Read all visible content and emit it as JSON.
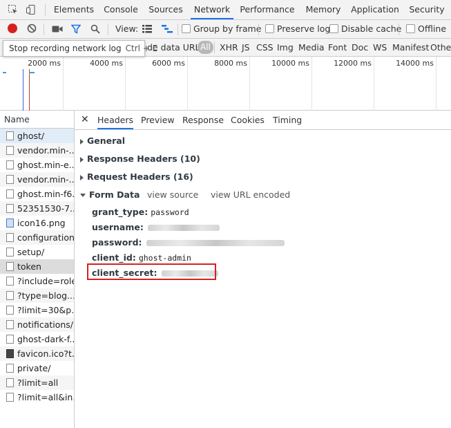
{
  "tabbar": {
    "tabs": [
      "Elements",
      "Console",
      "Sources",
      "Network",
      "Performance",
      "Memory",
      "Application",
      "Security"
    ],
    "active": "Network"
  },
  "toolbar": {
    "view_label": "View:",
    "group_by_frame": "Group by frame",
    "preserve_log": "Preserve log",
    "disable_cache": "Disable cache",
    "offline": "Offline"
  },
  "filter": {
    "hide_data_urls": "de data URLs",
    "types": [
      "All",
      "XHR",
      "JS",
      "CSS",
      "Img",
      "Media",
      "Font",
      "Doc",
      "WS",
      "Manifest",
      "Other"
    ]
  },
  "tooltip": {
    "text": "Stop recording network log",
    "shortcut": "Ctrl + E"
  },
  "overview": {
    "ticks": [
      "2000 ms",
      "4000 ms",
      "6000 ms",
      "8000 ms",
      "10000 ms",
      "12000 ms",
      "14000 ms"
    ]
  },
  "requests": {
    "header": "Name",
    "items": [
      {
        "name": "ghost/",
        "icon": "doc"
      },
      {
        "name": "vendor.min-...",
        "icon": "doc"
      },
      {
        "name": "ghost.min-e...",
        "icon": "doc"
      },
      {
        "name": "vendor.min-...",
        "icon": "doc"
      },
      {
        "name": "ghost.min-f6...",
        "icon": "doc"
      },
      {
        "name": "52351530-7...",
        "icon": "doc"
      },
      {
        "name": "icon16.png",
        "icon": "img"
      },
      {
        "name": "configuration/",
        "icon": "doc"
      },
      {
        "name": "setup/",
        "icon": "doc"
      },
      {
        "name": "token",
        "icon": "doc"
      },
      {
        "name": "?include=roles",
        "icon": "doc"
      },
      {
        "name": "?type=blog...",
        "icon": "doc"
      },
      {
        "name": "?limit=30&p...",
        "icon": "doc"
      },
      {
        "name": "notifications/",
        "icon": "doc"
      },
      {
        "name": "ghost-dark-f...",
        "icon": "doc"
      },
      {
        "name": "favicon.ico?t...",
        "icon": "fav"
      },
      {
        "name": "private/",
        "icon": "doc"
      },
      {
        "name": "?limit=all",
        "icon": "doc"
      },
      {
        "name": "?limit=all&in...",
        "icon": "doc"
      }
    ]
  },
  "details": {
    "tabs": [
      "Headers",
      "Preview",
      "Response",
      "Cookies",
      "Timing"
    ],
    "active": "Headers",
    "sections": {
      "general": "General",
      "response_headers": "Response Headers (10)",
      "request_headers": "Request Headers (16)",
      "form_data": "Form Data",
      "view_source": "view source",
      "view_url_encoded": "view URL encoded"
    },
    "form_data": {
      "grant_type_key": "grant_type:",
      "grant_type_val": "password",
      "username_key": "username:",
      "password_key": "password:",
      "client_id_key": "client_id:",
      "client_id_val": "ghost-admin",
      "client_secret_key": "client_secret:"
    }
  },
  "colors": {
    "accent": "#1a73e8",
    "record_red": "#d62020",
    "highlight_box": "#d62020"
  }
}
